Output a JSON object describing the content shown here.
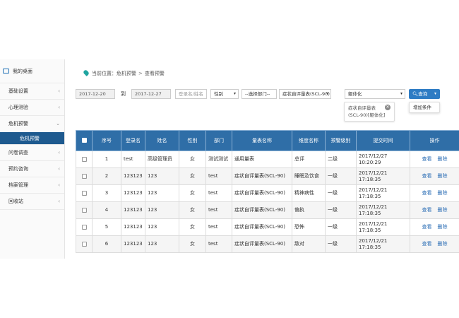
{
  "sidebar": {
    "items": [
      {
        "label": "我的桌面",
        "icon": "monitor-icon"
      },
      {
        "label": "基础设置",
        "chevron": "‹"
      },
      {
        "label": "心理测验",
        "chevron": "‹"
      },
      {
        "label": "危机预警",
        "chevron": "⌄"
      },
      {
        "label": "问卷调查",
        "chevron": "‹"
      },
      {
        "label": "预约咨询",
        "chevron": "‹"
      },
      {
        "label": "档案管理",
        "chevron": "‹"
      },
      {
        "label": "回收站",
        "chevron": "‹"
      }
    ],
    "active_sub": "危机预警"
  },
  "breadcrumb": {
    "prefix": "当前位置：",
    "level1": "危机预警",
    "sep": ">",
    "level2": "查看预警"
  },
  "filters": {
    "date_start": "2017-12-20",
    "to_label": "到",
    "date_end": "2017-12-27",
    "name_placeholder": "登录名/姓名",
    "gender": "性别",
    "department": "--选择部门--",
    "scale": "症状自评量表(SCL-90)",
    "factor": "躯体化",
    "query_button": "查询",
    "dropdown_item": "增加条件",
    "tag_line1": "症状自评量表",
    "tag_line2": "(SCL-90)[躯体化]"
  },
  "table": {
    "headers": [
      "",
      "序号",
      "登录名",
      "姓名",
      "性别",
      "部门",
      "量表名称",
      "维度名称",
      "预警级别",
      "提交时间",
      "操作"
    ],
    "view_label": "查看",
    "delete_label": "删除",
    "rows": [
      {
        "no": "1",
        "login": "test",
        "name": "高级管理员",
        "gender": "女",
        "dept": "测试测试",
        "scale": "通用量表",
        "dim": "总评",
        "level": "二级",
        "time": "2017/12/27 10:20:29"
      },
      {
        "no": "2",
        "login": "123123",
        "name": "123",
        "gender": "女",
        "dept": "test",
        "scale": "症状自评量表(SCL-90)",
        "dim": "睡眠及饮食",
        "level": "一级",
        "time": "2017/12/21 17:18:35"
      },
      {
        "no": "3",
        "login": "123123",
        "name": "123",
        "gender": "女",
        "dept": "test",
        "scale": "症状自评量表(SCL-90)",
        "dim": "精神病性",
        "level": "一级",
        "time": "2017/12/21 17:18:35"
      },
      {
        "no": "4",
        "login": "123123",
        "name": "123",
        "gender": "女",
        "dept": "test",
        "scale": "症状自评量表(SCL-90)",
        "dim": "偏执",
        "level": "一级",
        "time": "2017/12/21 17:18:35"
      },
      {
        "no": "5",
        "login": "123123",
        "name": "123",
        "gender": "女",
        "dept": "test",
        "scale": "症状自评量表(SCL-90)",
        "dim": "恐怖",
        "level": "一级",
        "time": "2017/12/21 17:18:35"
      },
      {
        "no": "6",
        "login": "123123",
        "name": "123",
        "gender": "女",
        "dept": "test",
        "scale": "症状自评量表(SCL-90)",
        "dim": "敌对",
        "level": "一级",
        "time": "2017/12/21 17:18:35"
      }
    ]
  },
  "colors": {
    "header_blue": "#2f6ea7",
    "active_nav": "#1e5a8f",
    "link_blue": "#2a6db5",
    "button_blue": "#2e7cc4"
  }
}
